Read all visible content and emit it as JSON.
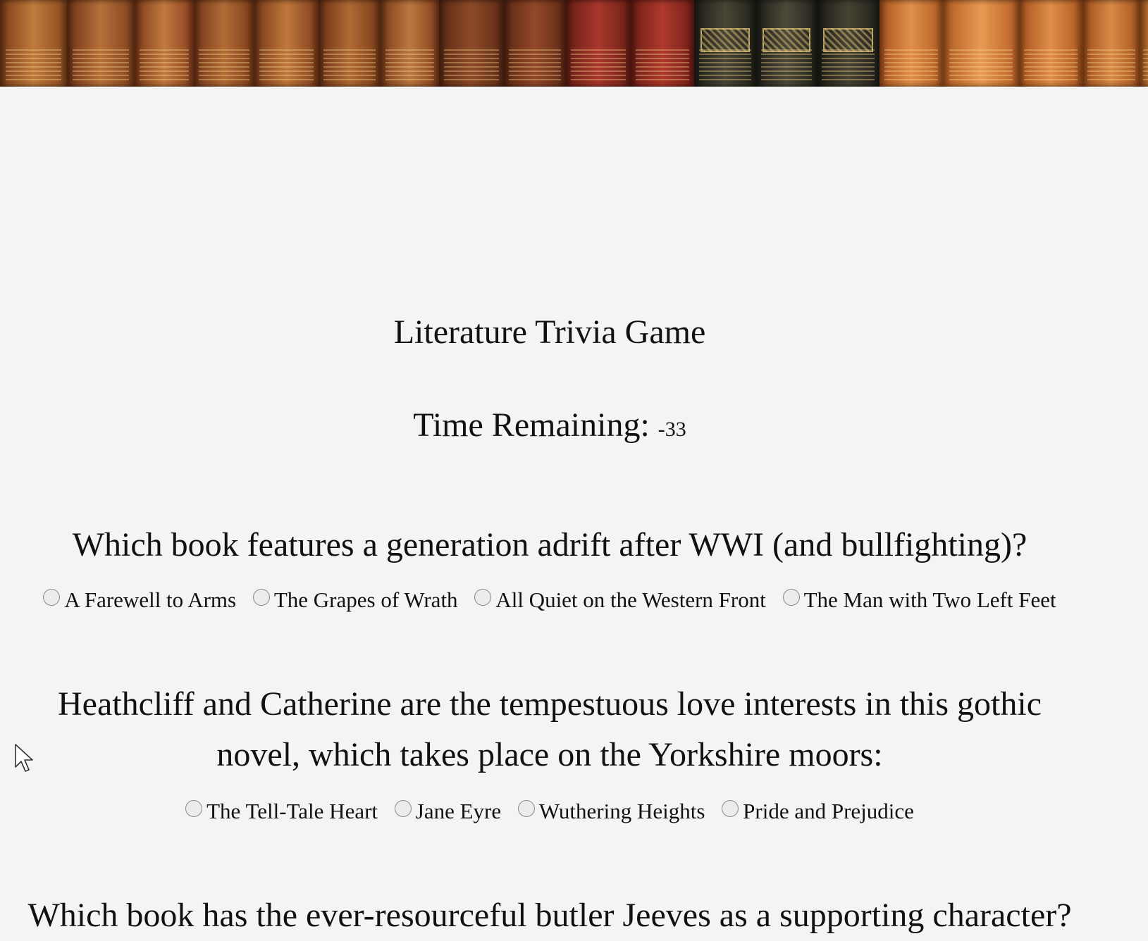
{
  "app": {
    "title": "Literature Trivia Game",
    "timer_label": "Time Remaining:",
    "timer_value": "-33"
  },
  "banner": {
    "icon": "bookshelf-banner",
    "spine_colors": [
      "#a0562a",
      "#8f4a20",
      "#b06a30",
      "#7d3a1a",
      "#9c5026",
      "#b46a34",
      "#8a4420",
      "#a55c2a",
      "#6e2c16",
      "#7a3418",
      "#8b2a1c",
      "#922e20",
      "#2b2b24",
      "#35332a",
      "#2f2f27",
      "#c56a2c",
      "#d27a34",
      "#c8702e",
      "#b8662a"
    ]
  },
  "questions": [
    {
      "text": "Which book features a generation adrift after WWI (and bullfighting)?",
      "options": [
        "A Farewell to Arms",
        "The Grapes of Wrath",
        "All Quiet on the Western Front",
        "The Man with Two Left Feet"
      ]
    },
    {
      "text": "Heathcliff and Catherine are the tempestuous love interests in this gothic novel, which takes place on the Yorkshire moors:",
      "options": [
        "The Tell-Tale Heart",
        "Jane Eyre",
        "Wuthering Heights",
        "Pride and Prejudice"
      ]
    },
    {
      "text": "Which book has the ever-resourceful butler Jeeves as a supporting character?",
      "options": []
    }
  ]
}
